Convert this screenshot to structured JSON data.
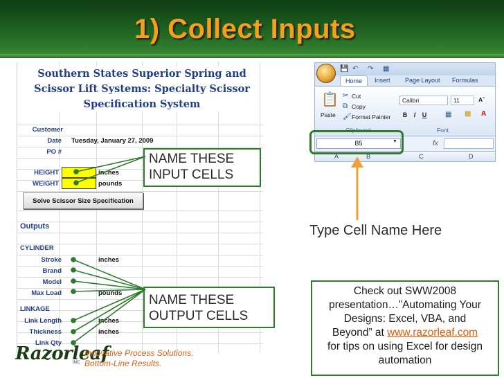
{
  "slide": {
    "title": "1) Collect Inputs"
  },
  "sheet": {
    "title_lines": [
      "Southern States Superior Spring and",
      "Scissor Lift Systems: Specialty Scissor",
      "Specification System"
    ],
    "fields": {
      "customer": "Customer",
      "date_label": "Date",
      "date_value": "Tuesday, January 27, 2009",
      "po_label": "PO #",
      "height_label": "HEIGHT",
      "height_unit": "inches",
      "weight_label": "WEIGHT",
      "weight_unit": "pounds"
    },
    "solve_button": "Solve Scissor Size Specification",
    "outputs_heading": "Outputs",
    "cylinder_heading": "CYLINDER",
    "cylinder_rows": [
      {
        "label": "Stroke",
        "unit": "inches"
      },
      {
        "label": "Brand",
        "unit": ""
      },
      {
        "label": "Model",
        "unit": ""
      },
      {
        "label": "Max Load",
        "unit": "pounds"
      }
    ],
    "linkage_heading": "LINKAGE",
    "linkage_rows": [
      {
        "label": "Link Length",
        "unit": "inches"
      },
      {
        "label": "Thickness",
        "unit": "inches"
      },
      {
        "label": "Link Qty",
        "unit": ""
      }
    ]
  },
  "callouts": {
    "input_lines": [
      "NAME THESE",
      "INPUT CELLS"
    ],
    "output_lines": [
      "NAME THESE",
      "OUTPUT CELLS"
    ]
  },
  "ribbon": {
    "tabs": [
      "Home",
      "Insert",
      "Page Layout",
      "Formulas"
    ],
    "clipboard": {
      "cut": "Cut",
      "copy": "Copy",
      "format_painter": "Format Painter",
      "paste": "Paste",
      "group": "Clipboard"
    },
    "font": {
      "name": "Calibri",
      "size": "11",
      "group": "Font"
    },
    "format_buttons": [
      "B",
      "I",
      "U"
    ],
    "name_box": "B5",
    "fx": "fx",
    "columns": [
      "A",
      "B",
      "C",
      "D"
    ]
  },
  "type_here": "Type Cell Name Here",
  "info": {
    "lines": [
      "Check out SWW2008",
      "presentation…”Automating Your",
      "Designs: Excel, VBA, and"
    ],
    "line4_prefix": "Beyond” at ",
    "link": "www.razorleaf.com",
    "lines_after": [
      "for tips on using Excel for design",
      "automation"
    ]
  },
  "logo": {
    "name": "Razorleaf",
    "tm": "INC",
    "tagline_lines": [
      "Innovative Process Solutions.",
      "Bottom-Line Results."
    ]
  },
  "colors": {
    "title": "#f4a01c",
    "band": "#1d5c1f",
    "sheet_text": "#233e88",
    "accent_green": "#2e7a2c",
    "link": "#e05a00",
    "tagline": "#d7611a",
    "input_fill": "#ffff00"
  }
}
